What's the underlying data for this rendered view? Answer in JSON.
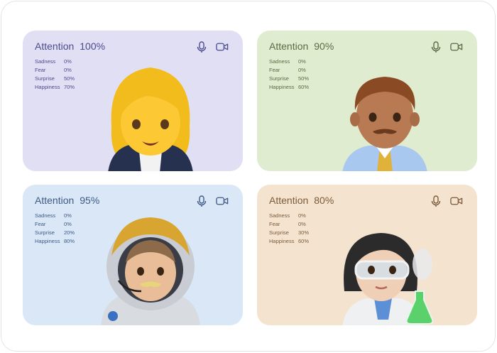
{
  "attention_label": "Attention",
  "participants": [
    {
      "attention": "100%",
      "avatar": "woman-emoji",
      "emotions": [
        {
          "label": "Sadness",
          "value": "0%"
        },
        {
          "label": "Fear",
          "value": "0%"
        },
        {
          "label": "Surprise",
          "value": "50%"
        },
        {
          "label": "Happiness",
          "value": "70%"
        }
      ]
    },
    {
      "attention": "90%",
      "avatar": "man-emoji",
      "emotions": [
        {
          "label": "Sadness",
          "value": "0%"
        },
        {
          "label": "Fear",
          "value": "0%"
        },
        {
          "label": "Surprise",
          "value": "50%"
        },
        {
          "label": "Happiness",
          "value": "60%"
        }
      ]
    },
    {
      "attention": "95%",
      "avatar": "astronaut-emoji",
      "emotions": [
        {
          "label": "Sadness",
          "value": "0%"
        },
        {
          "label": "Fear",
          "value": "0%"
        },
        {
          "label": "Surprise",
          "value": "20%"
        },
        {
          "label": "Happiness",
          "value": "80%"
        }
      ]
    },
    {
      "attention": "80%",
      "avatar": "scientist-emoji",
      "emotions": [
        {
          "label": "Sadness",
          "value": "0%"
        },
        {
          "label": "Fear",
          "value": "0%"
        },
        {
          "label": "Surprise",
          "value": "30%"
        },
        {
          "label": "Happiness",
          "value": "60%"
        }
      ]
    }
  ],
  "icons": {
    "microphone": "microphone-icon",
    "camera": "video-camera-icon"
  },
  "colors": {
    "card_purple": "#e1dff4",
    "card_green": "#dfeccf",
    "card_blue": "#d9e7f6",
    "card_peach": "#f4e3cf"
  }
}
